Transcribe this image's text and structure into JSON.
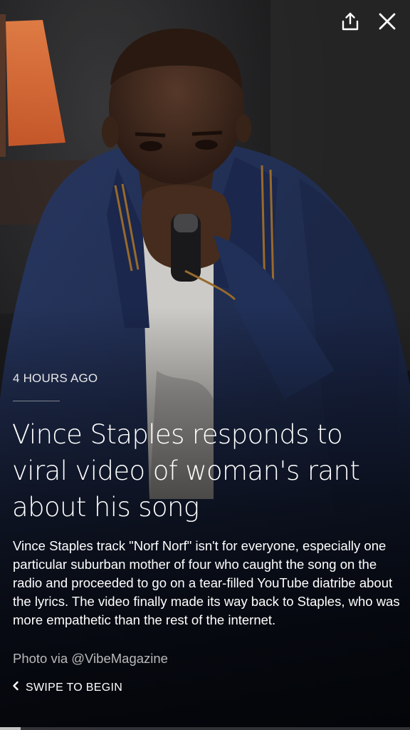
{
  "story": {
    "timestamp": "4 HOURS AGO",
    "headline": "Vince Staples responds to viral video of woman's rant about his song",
    "summary": "Vince Staples track \"Norf Norf\" isn't for everyone, especially one particular suburban mother of four who caught the song on the radio and proceeded to go on a tear-filled YouTube diatribe about the lyrics. The video finally made its way back to Staples, who was more empathetic than the rest of the internet.",
    "photo_credit": "Photo via @VibeMagazine"
  },
  "controls": {
    "share_icon": "share-icon",
    "close_icon": "close-icon",
    "swipe_label": "SWIPE TO BEGIN",
    "swipe_icon": "chevron-left-icon"
  },
  "progress": {
    "fraction": 0.05
  },
  "colors": {
    "text": "#ffffff",
    "muted": "#b9b9b9",
    "jacket": "#1f2d52",
    "stripe": "#a0702e"
  }
}
